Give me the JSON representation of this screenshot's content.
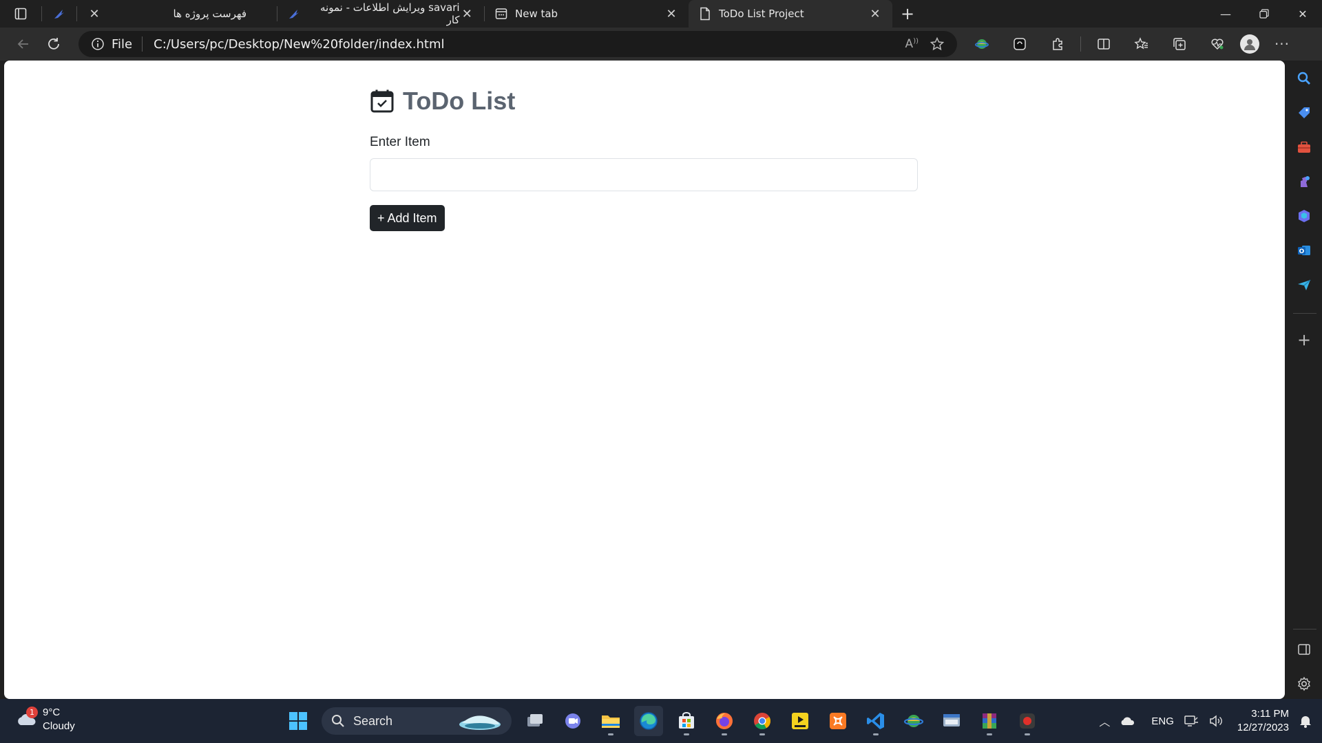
{
  "browser": {
    "tabs": [
      {
        "label": "",
        "icon": "feather-icon",
        "pinned": true
      },
      {
        "label": "فهرست پروژه ها",
        "icon": "feather-icon"
      },
      {
        "label": "savari ویرایش اطلاعات - نمونه کار",
        "icon": "feather-icon"
      },
      {
        "label": "New tab",
        "icon": "newtab-icon"
      },
      {
        "label": "ToDo List Project",
        "icon": "page-icon",
        "active": true
      }
    ],
    "address": {
      "scheme_label": "File",
      "url": "C:/Users/pc/Desktop/New%20folder/index.html"
    }
  },
  "page": {
    "title": "ToDo List",
    "input_label": "Enter Item",
    "input_value": "",
    "add_button_label": "+ Add Item"
  },
  "taskbar": {
    "weather": {
      "temperature": "9°C",
      "condition": "Cloudy",
      "badge": "1"
    },
    "search_label": "Search",
    "tray": {
      "language": "ENG",
      "time": "3:11 PM",
      "date": "12/27/2023"
    }
  },
  "colors": {
    "title": "#5b6470",
    "button_bg": "#212529",
    "taskbar_bg": "#1c2433",
    "browser_bg": "#202020"
  }
}
